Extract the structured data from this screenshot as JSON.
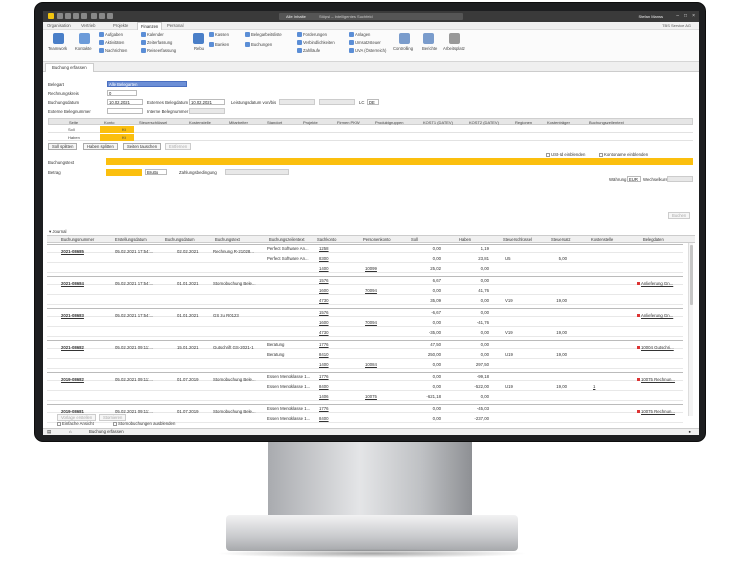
{
  "titlebar": {
    "search_label": "Alle Inhalte",
    "search_placeholder": "Stöpsl – Intelligentes Suchfeld",
    "user": "Stefan Manss"
  },
  "menus": [
    "Organisation",
    "Vertrieb",
    "Projekte",
    "Finanzen",
    "Personal"
  ],
  "active_menu": "Finanzen",
  "company": "TBS Service AG",
  "ribbon": {
    "teamwork": "Teamwork",
    "kontakte": "Kontakte",
    "aufgaben": "Aufgaben",
    "aktivitaeten": "Aktivitäten",
    "nachrichten": "Nachrichten",
    "kalender": "Kalender",
    "zeiterfassung": "Zeiterfassung",
    "reiseerfassung": "Reiseerfassung",
    "rebu": "Rebu",
    "kassen": "Kassen",
    "banken": "Banken",
    "belegarbeitsliste": "Belegarbeitsliste",
    "buchungen": "Buchungen",
    "forderungen": "Forderungen",
    "verbindlichkeiten": "Verbindlichkeiten",
    "zahllaeufe": "Zahlläufe",
    "anlagen": "Anlagen",
    "umsatzsteuer": "Umsatzsteuer",
    "uva": "UVA (Österreich)",
    "controlling": "Controlling",
    "berichte": "Berichte",
    "arbeitsplatz": "Arbeitsplatz"
  },
  "doc_tab": "Buchung erfassen",
  "form": {
    "belegart_label": "Belegart",
    "belegart_value": "Alle Belegarten",
    "rechnungskreis_label": "Rechnungskreis",
    "rechnungskreis_value": "0",
    "buchungsdatum_label": "Buchungsdatum",
    "buchungsdatum_value": "10.02.2021",
    "ext_belegdatum_label": "Externes Belegdatum",
    "ext_belegdatum_value": "10.02.2021",
    "leistungsdatum_label": "Leistungsdatum von/bis",
    "lc_label": "LC",
    "lc_value": "DE",
    "ext_belegnummer_label": "Externe Belegnummer",
    "int_belegnummer_label": "Interne Belegnummer"
  },
  "booking_grid": {
    "columns": [
      "Seite",
      "Konto",
      "Steuerschlüssel",
      "Kostenstelle",
      "Mitarbeiter",
      "Standort",
      "Projekte",
      "Firmen PKW",
      "Produktgruppen",
      "KOST1 (DATEV)",
      "KOST2 (DATEV)",
      "Regionen",
      "Kostenträger",
      "Buchungszeilentext"
    ],
    "rows": [
      {
        "seite": "Soll",
        "kto": "Kt"
      },
      {
        "seite": "Haben",
        "kto": "Kt"
      }
    ]
  },
  "buttons": {
    "soll_splitten": "Soll splitten",
    "haben_splitten": "Haben splitten",
    "seiten_tauschen": "Seiten tauschen",
    "entfernen": "Entfernen",
    "buchen": "Buchen",
    "vorlage": "Vorlage erstellen",
    "stornieren": "Stornieren"
  },
  "checks": {
    "ust": "USt-Id einblenden",
    "kontoname": "Kontoname einblenden",
    "einfache": "Einfache Ansicht",
    "storno": "Stornobuchungen ausblenden"
  },
  "text_labels": {
    "buchungstext": "Buchungstext",
    "betrag": "Betrag",
    "brutto": "Brutto",
    "zahlungsbedingung": "Zahlungsbedingung",
    "waehrung": "Währung",
    "waehrung_value": "EUR",
    "wechselkurs": "Wechselkurs"
  },
  "journal": {
    "title": "Journal",
    "columns": [
      "Buchungsnummer",
      "Erstellungsdatum",
      "Buchungsdatum",
      "Buchungstext",
      "Buchungszeilentext",
      "Sachkonto",
      "Personenkonto",
      "Soll",
      "Haben",
      "Steuerschlüssel",
      "Steuersatz",
      "Kostenstelle",
      "Belegdaten"
    ],
    "groups": [
      {
        "nr": "2021-08685",
        "erst": "05.02.2021 17:54:...",
        "bd": "02.02.2021",
        "text": "Rechnung R-21028...",
        "beleg": "",
        "lines": [
          {
            "zt": "Perfect Software An...",
            "sk": "1258",
            "pk": "",
            "soll": "0,00",
            "haben": "1,19",
            "ss": "",
            "sz": "",
            "ks": ""
          },
          {
            "zt": "Perfect Software An...",
            "sk": "8300",
            "pk": "",
            "soll": "0,00",
            "haben": "23,81",
            "ss": "U5",
            "sz": "5,00",
            "ks": ""
          },
          {
            "zt": "",
            "sk": "1400",
            "pk": "10099",
            "soll": "25,02",
            "haben": "0,00",
            "ss": "",
            "sz": "",
            "ks": ""
          }
        ]
      },
      {
        "nr": "2021-08684",
        "erst": "05.02.2021 17:54:...",
        "bd": "01.01.2021",
        "text": "Stornobuchung Bele...",
        "beleg": "Anlieferung Gn...",
        "lines": [
          {
            "zt": "",
            "sk": "1576",
            "pk": "",
            "soll": "6,67",
            "haben": "0,00",
            "ss": "",
            "sz": "",
            "ks": ""
          },
          {
            "zt": "",
            "sk": "1600",
            "pk": "70094",
            "soll": "0,00",
            "haben": "41,76",
            "ss": "",
            "sz": "",
            "ks": ""
          },
          {
            "zt": "",
            "sk": "4730",
            "pk": "",
            "soll": "35,09",
            "haben": "0,00",
            "ss": "V19",
            "sz": "19,00",
            "ks": ""
          }
        ]
      },
      {
        "nr": "2021-08683",
        "erst": "05.02.2021 17:54:...",
        "bd": "01.01.2021",
        "text": "GS zu R0123",
        "beleg": "Anlieferung Gn...",
        "lines": [
          {
            "zt": "",
            "sk": "1576",
            "pk": "",
            "soll": "-6,67",
            "haben": "0,00",
            "ss": "",
            "sz": "",
            "ks": ""
          },
          {
            "zt": "",
            "sk": "1600",
            "pk": "70094",
            "soll": "0,00",
            "haben": "-41,76",
            "ss": "",
            "sz": "",
            "ks": ""
          },
          {
            "zt": "",
            "sk": "4730",
            "pk": "",
            "soll": "-35,00",
            "haben": "0,00",
            "ss": "V19",
            "sz": "19,00",
            "ks": ""
          }
        ]
      },
      {
        "nr": "2021-08682",
        "erst": "05.02.2021 09:11:...",
        "bd": "15.01.2021",
        "text": "Gutschrift GS-2021-1",
        "beleg": "10004 Gutschri...",
        "lines": [
          {
            "zt": "Beratung",
            "sk": "1776",
            "pk": "",
            "soll": "47,50",
            "haben": "0,00",
            "ss": "",
            "sz": "",
            "ks": ""
          },
          {
            "zt": "Beratung",
            "sk": "8410",
            "pk": "",
            "soll": "250,00",
            "haben": "0,00",
            "ss": "U19",
            "sz": "19,00",
            "ks": ""
          },
          {
            "zt": "",
            "sk": "1400",
            "pk": "10084",
            "soll": "0,00",
            "haben": "297,50",
            "ss": "",
            "sz": "",
            "ks": ""
          }
        ]
      },
      {
        "nr": "2019-08682",
        "erst": "05.02.2021 09:11:...",
        "bd": "01.07.2019",
        "text": "Stornobuchung Bele...",
        "beleg": "10075 Rechnun...",
        "lines": [
          {
            "zt": "Essen Menüklasse 1...",
            "sk": "1776",
            "pk": "",
            "soll": "0,00",
            "haben": "-99,18",
            "ss": "",
            "sz": "",
            "ks": ""
          },
          {
            "zt": "Essen Menüklasse 1...",
            "sk": "8400",
            "pk": "",
            "soll": "0,00",
            "haben": "-522,00",
            "ss": "U19",
            "sz": "19,00",
            "ks": "1"
          },
          {
            "zt": "",
            "sk": "1406",
            "pk": "10075",
            "soll": "-621,18",
            "haben": "0,00",
            "ss": "",
            "sz": "",
            "ks": ""
          }
        ]
      },
      {
        "nr": "2019-08681",
        "erst": "05.02.2021 09:11:...",
        "bd": "01.07.2019",
        "text": "Stornobuchung Bele...",
        "beleg": "10075 Rechnun...",
        "lines": [
          {
            "zt": "Essen Menüklasse 1...",
            "sk": "1776",
            "pk": "",
            "soll": "0,00",
            "haben": "-45,03",
            "ss": "",
            "sz": "",
            "ks": ""
          },
          {
            "zt": "Essen Menüklasse 1...",
            "sk": "8400",
            "pk": "",
            "soll": "0,00",
            "haben": "-237,00",
            "ss": "",
            "sz": "",
            "ks": ""
          }
        ]
      }
    ]
  },
  "status": {
    "text": "Buchung erfassen"
  }
}
